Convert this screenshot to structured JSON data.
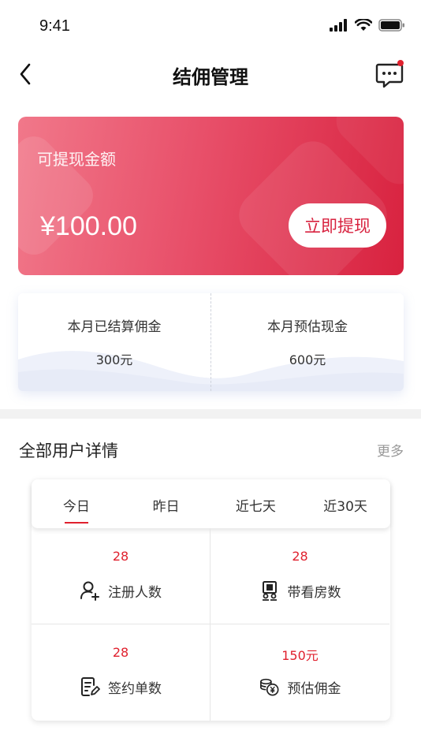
{
  "status_bar": {
    "time": "9:41"
  },
  "nav": {
    "title": "结佣管理"
  },
  "withdraw_card": {
    "label": "可提现金额",
    "amount": "¥100.00",
    "button_label": "立即提现"
  },
  "monthly": {
    "settled": {
      "label": "本月已结算佣金",
      "value": "300元"
    },
    "estimated": {
      "label": "本月预估现金",
      "value": "600元"
    }
  },
  "users_section": {
    "title": "全部用户详情",
    "more_label": "更多",
    "tabs": [
      {
        "label": "今日",
        "active": true
      },
      {
        "label": "昨日",
        "active": false
      },
      {
        "label": "近七天",
        "active": false
      },
      {
        "label": "近30天",
        "active": false
      }
    ],
    "stats": [
      {
        "value": "28",
        "label": "注册人数",
        "icon": "user-add-icon"
      },
      {
        "value": "28",
        "label": "带看房数",
        "icon": "house-viewing-icon"
      },
      {
        "value": "28",
        "label": "签约单数",
        "icon": "contract-icon"
      },
      {
        "value": "150元",
        "label": "预估佣金",
        "icon": "coins-icon"
      }
    ]
  },
  "colors": {
    "accent": "#e0212e",
    "card_gradient_start": "#f1788a",
    "card_gradient_end": "#d8223f"
  }
}
